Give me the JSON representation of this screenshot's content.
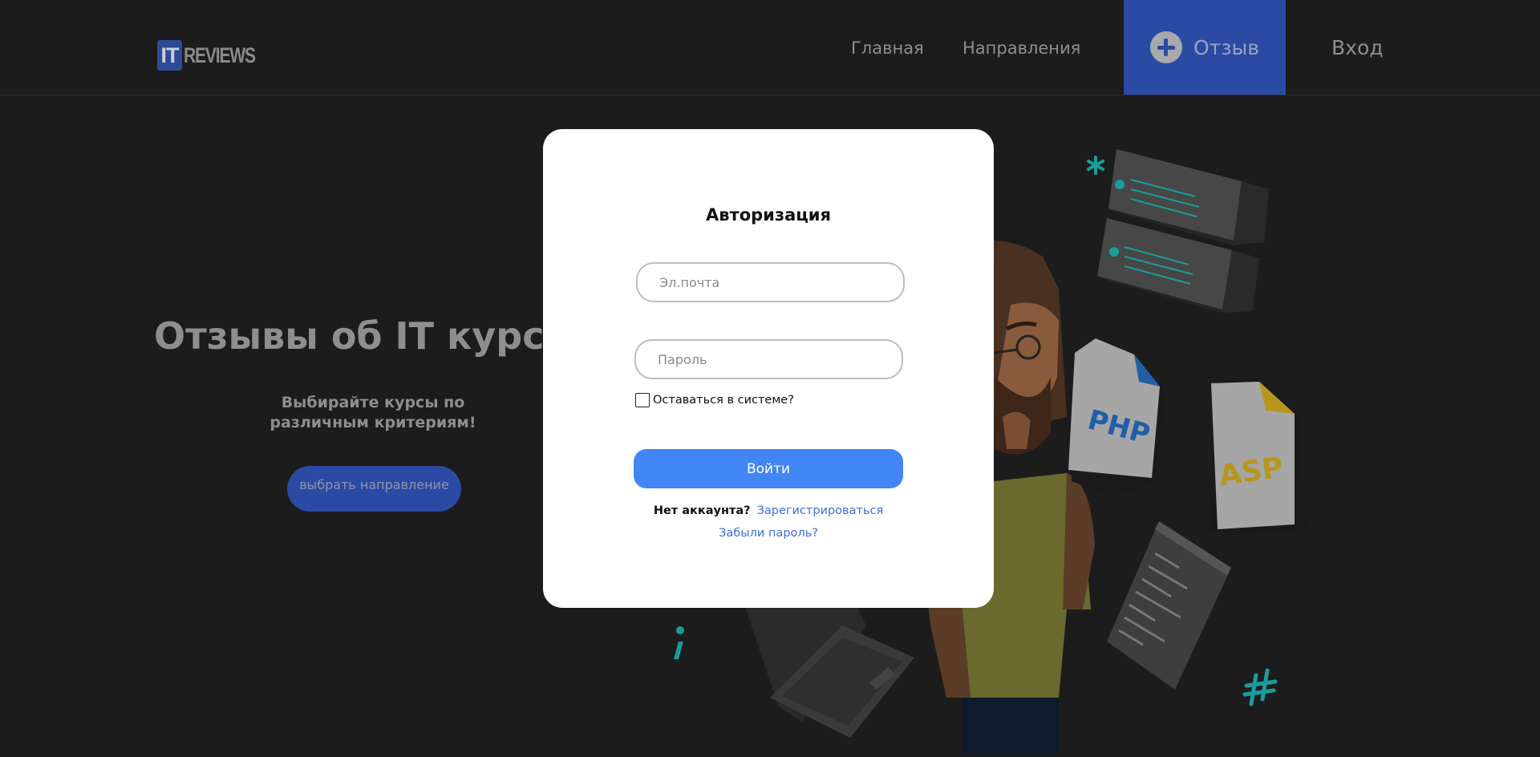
{
  "header": {
    "logo_it": "IT",
    "logo_reviews": "REVIEWS",
    "nav": {
      "home": "Главная",
      "directions": "Направления",
      "review": "Отзыв",
      "login": "Вход"
    }
  },
  "hero": {
    "title": "Отзывы об IT курс",
    "subtitle_line1": "Выбирайте курсы по",
    "subtitle_line2": "различным критериям!",
    "button": "выбрать направление"
  },
  "illustration": {
    "php_label": "PHP",
    "asp_label": "ASP",
    "accent_color": "#1fa3a3"
  },
  "modal": {
    "title": "Авторизация",
    "email_placeholder": "Эл.почта",
    "password_placeholder": "Пароль",
    "remember_label": "Оставаться в системе?",
    "remember_checked": false,
    "submit": "Войти",
    "no_account": "Нет аккаунта?",
    "register_link": "Зарегистрироваться",
    "forgot_link": "Забыли пароль?"
  },
  "colors": {
    "background": "#1c1c1c",
    "brand_blue": "#2b4aa4",
    "button_blue": "#4285f4",
    "link_blue": "#3b6fd4"
  }
}
